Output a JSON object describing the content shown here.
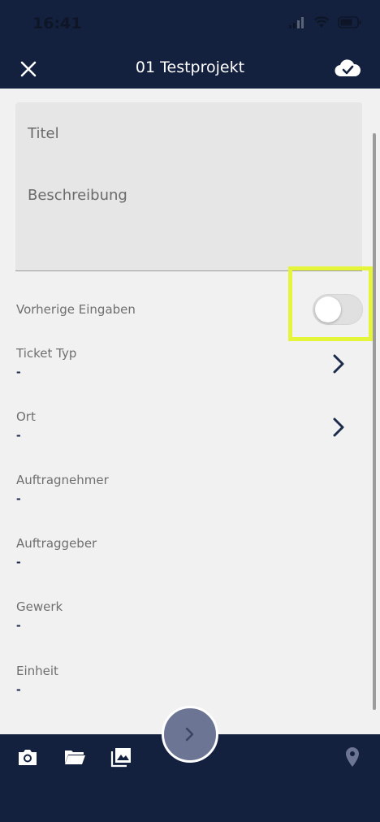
{
  "status_bar": {
    "time": "16:41"
  },
  "header": {
    "title": "01 Testprojekt",
    "close_icon": "close-icon",
    "save_icon": "cloud-check-icon"
  },
  "form": {
    "title_label": "Titel",
    "description_label": "Beschreibung",
    "previous_entries": {
      "label": "Vorherige Eingaben",
      "enabled": false
    },
    "rows": [
      {
        "label": "Ticket Typ",
        "value": "-",
        "has_chevron": true
      },
      {
        "label": "Ort",
        "value": "-",
        "has_chevron": true
      },
      {
        "label": "Auftragnehmer",
        "value": "-",
        "has_chevron": false
      },
      {
        "label": "Auftraggeber",
        "value": "-",
        "has_chevron": false
      },
      {
        "label": "Gewerk",
        "value": "-",
        "has_chevron": false
      },
      {
        "label": "Einheit",
        "value": "-",
        "has_chevron": false
      }
    ]
  },
  "bottom_bar": {
    "icons": [
      "camera-icon",
      "folder-icon",
      "gallery-icon",
      "location-pin-icon"
    ],
    "fab_icon": "chevron-right-icon"
  },
  "colors": {
    "header_bg": "#13213f",
    "highlight": "#e4f53a",
    "fab": "#6c7594"
  }
}
